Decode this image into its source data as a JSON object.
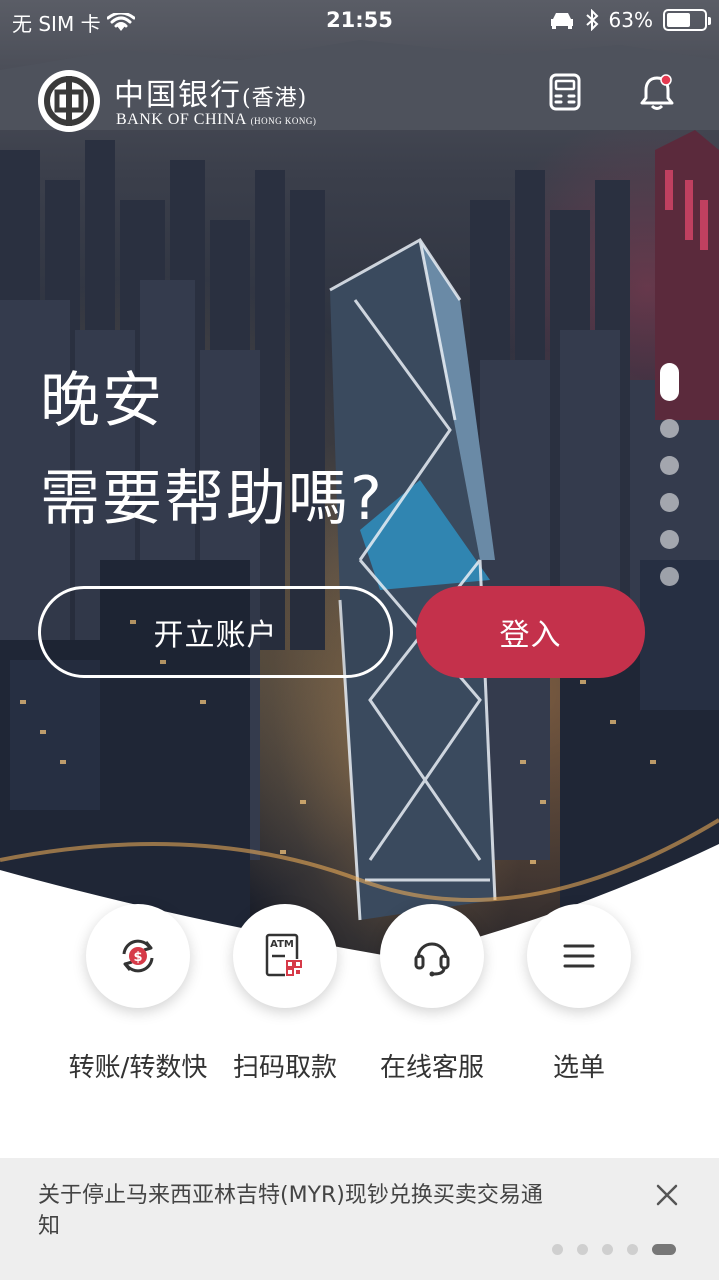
{
  "status_bar": {
    "carrier": "无 SIM 卡",
    "time": "21:55",
    "battery": "63%",
    "battery_level": 0.63
  },
  "header": {
    "logo_cn": "中国银行",
    "logo_cn_suffix": "(香港)",
    "logo_en": "BANK OF CHINA",
    "logo_en_suffix": "(HONG KONG)",
    "calculator_icon": "calculator-icon",
    "bell_icon": "bell-icon"
  },
  "hero": {
    "greeting": "晚安",
    "subtitle": "需要帮助嗎?",
    "carousel_count": 6,
    "carousel_active": 0
  },
  "buttons": {
    "open_account": "开立账户",
    "login": "登入"
  },
  "quick_actions": [
    {
      "label": "转账/转数快",
      "icon": "transfer-dollar-icon"
    },
    {
      "label": "扫码取款",
      "icon": "atm-qr-icon"
    },
    {
      "label": "在线客服",
      "icon": "headset-icon"
    },
    {
      "label": "选单",
      "icon": "menu-icon"
    }
  ],
  "notice": {
    "text": "关于停止马来西亚林吉特(MYR)现钞兑换买卖交易通知",
    "page_count": 5,
    "page_active": 4
  },
  "colors": {
    "accent": "#c4314b",
    "notice_bg": "#eeeeee",
    "text_dark": "#333333"
  }
}
